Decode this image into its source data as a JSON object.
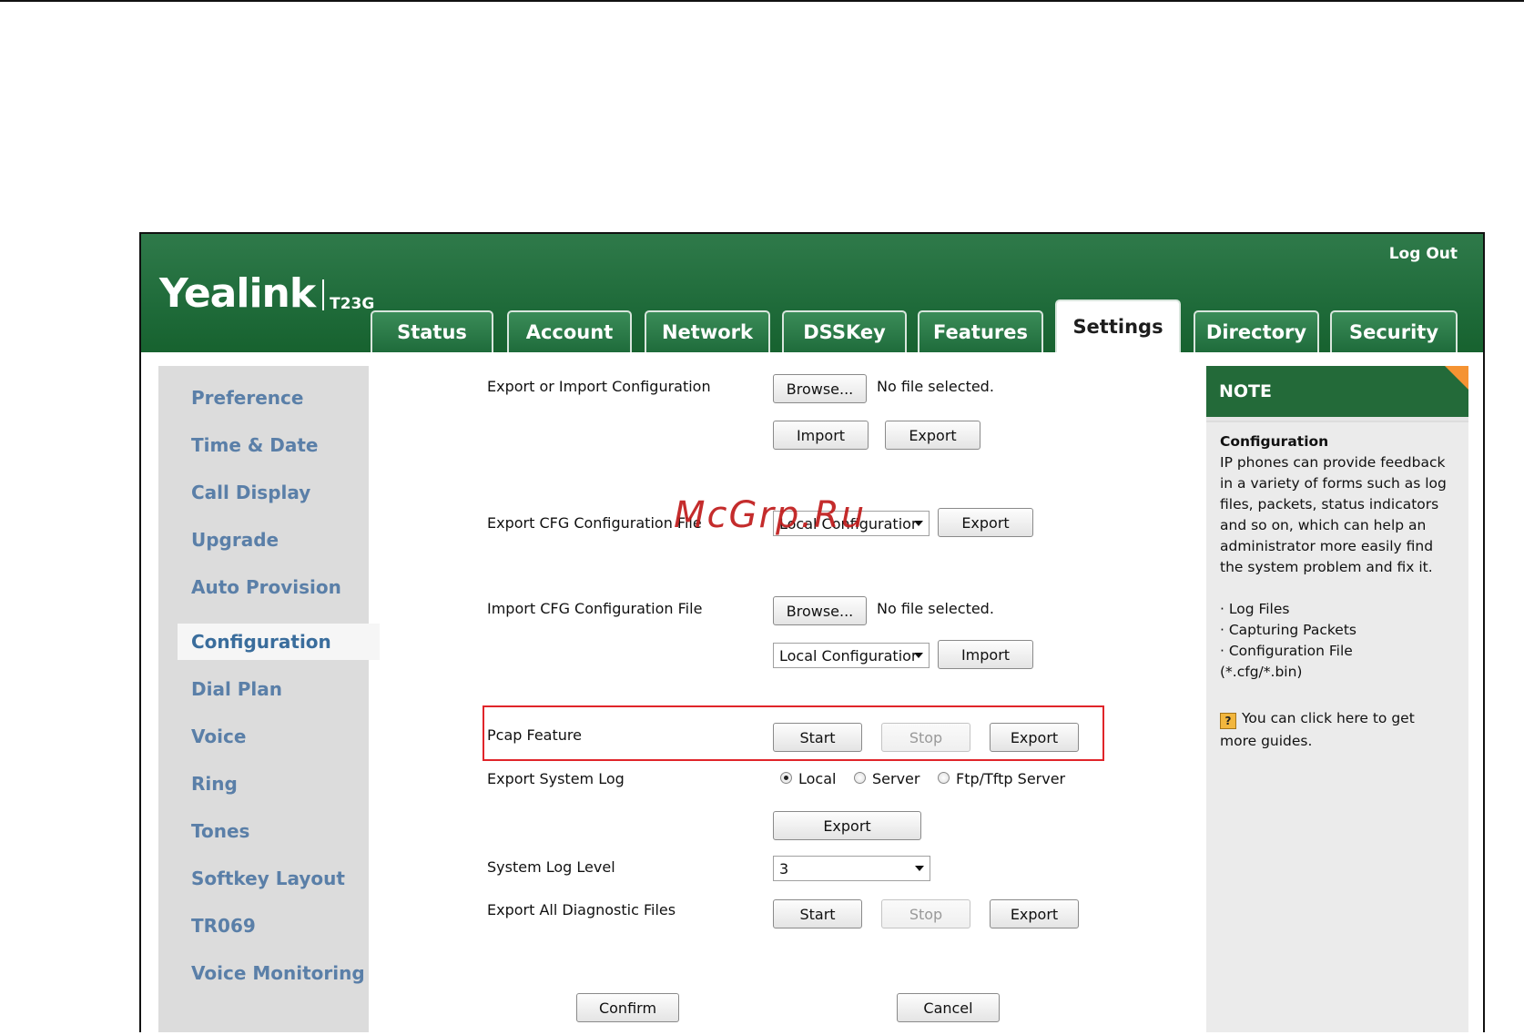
{
  "header": {
    "logout": "Log Out",
    "brand": "Yealink",
    "model": "T23G"
  },
  "tabs": [
    {
      "label": "Status"
    },
    {
      "label": "Account"
    },
    {
      "label": "Network"
    },
    {
      "label": "DSSKey"
    },
    {
      "label": "Features"
    },
    {
      "label": "Settings"
    },
    {
      "label": "Directory"
    },
    {
      "label": "Security"
    }
  ],
  "sidebar": {
    "items": [
      {
        "label": "Preference"
      },
      {
        "label": "Time & Date"
      },
      {
        "label": "Call Display"
      },
      {
        "label": "Upgrade"
      },
      {
        "label": "Auto Provision"
      },
      {
        "label": "Configuration"
      },
      {
        "label": "Dial Plan"
      },
      {
        "label": "Voice"
      },
      {
        "label": "Ring"
      },
      {
        "label": "Tones"
      },
      {
        "label": "Softkey Layout"
      },
      {
        "label": "TR069"
      },
      {
        "label": "Voice Monitoring"
      }
    ]
  },
  "form": {
    "export_import_config": {
      "label": "Export or Import Configuration",
      "browse": "Browse...",
      "file_status": "No file selected.",
      "import": "Import",
      "export": "Export"
    },
    "export_cfg": {
      "label": "Export CFG Configuration File",
      "select": "Local Configuratior",
      "export": "Export"
    },
    "import_cfg": {
      "label": "Import CFG Configuration File",
      "browse": "Browse...",
      "file_status": "No file selected.",
      "select": "Local Configuratior",
      "import": "Import"
    },
    "pcap": {
      "label": "Pcap Feature",
      "start": "Start",
      "stop": "Stop",
      "export": "Export"
    },
    "system_log": {
      "label": "Export System Log",
      "options": [
        "Local",
        "Server",
        "Ftp/Tftp Server"
      ],
      "selected": "Local",
      "export": "Export"
    },
    "log_level": {
      "label": "System Log Level",
      "value": "3"
    },
    "diagnostic": {
      "label": "Export All Diagnostic Files",
      "start": "Start",
      "stop": "Stop",
      "export": "Export"
    },
    "confirm": "Confirm",
    "cancel": "Cancel"
  },
  "note": {
    "title": "NOTE",
    "heading": "Configuration",
    "lines": [
      "IP phones can provide feedback",
      "in a variety of forms such as log",
      "files, packets, status indicators",
      "and so on, which can help an",
      "administrator more easily find",
      "the system problem and fix it."
    ],
    "bullets": [
      "· Log Files",
      "· Capturing Packets",
      "· Configuration File",
      "(*.cfg/*.bin)"
    ],
    "guide_icon": "?",
    "guide_line1": "You can click here to get",
    "guide_line2": "more guides."
  },
  "watermark": "McGrp.Ru",
  "colors": {
    "header_green": "#1f6b3a",
    "sidebar_text": "#5a7fa8",
    "highlight_red": "#e0252a",
    "note_accent": "#f59332"
  }
}
